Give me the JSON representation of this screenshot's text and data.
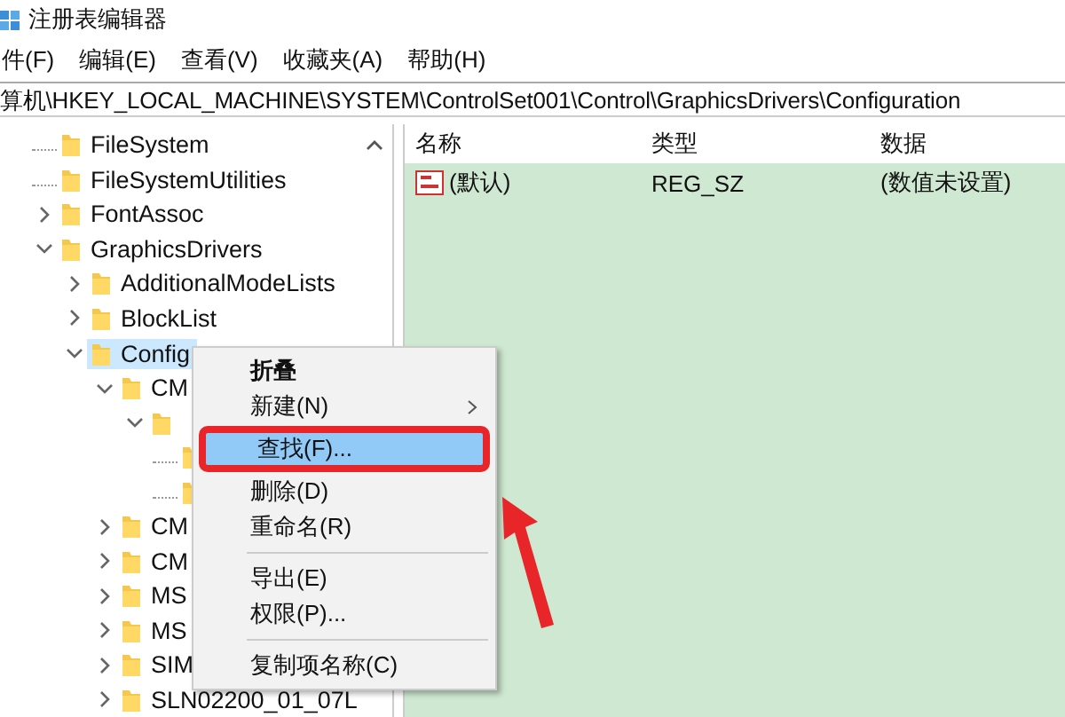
{
  "window": {
    "title": "注册表编辑器"
  },
  "menu_bar": [
    "件(F)",
    "编辑(E)",
    "查看(V)",
    "收藏夹(A)",
    "帮助(H)"
  ],
  "address_bar": {
    "value": "算机\\HKEY_LOCAL_MACHINE\\SYSTEM\\ControlSet001\\Control\\GraphicsDrivers\\Configuration"
  },
  "tree": [
    {
      "label": "FileSystem",
      "kind": "leaf",
      "selected": false
    },
    {
      "label": "FileSystemUtilities",
      "kind": "leaf",
      "selected": false
    },
    {
      "label": "FontAssoc",
      "kind": "branch",
      "expanded": false,
      "selected": false
    },
    {
      "label": "GraphicsDrivers",
      "kind": "branch",
      "expanded": true,
      "selected": false,
      "children": [
        {
          "label": "AdditionalModeLists",
          "kind": "branch",
          "expanded": false,
          "selected": false
        },
        {
          "label": "BlockList",
          "kind": "branch",
          "expanded": false,
          "selected": false
        },
        {
          "label": "Config",
          "kind": "branch",
          "expanded": true,
          "selected": true,
          "children": [
            {
              "label": "CM",
              "kind": "branch",
              "expanded": true,
              "selected": false,
              "children": [
                {
                  "kind": "branch",
                  "expanded": true,
                  "selected": false,
                  "children": [
                    {
                      "kind": "leaf",
                      "selected": false
                    },
                    {
                      "kind": "leaf",
                      "selected": false
                    }
                  ]
                }
              ]
            },
            {
              "label": "CM",
              "kind": "branch",
              "expanded": false,
              "selected": false
            },
            {
              "label": "CM",
              "kind": "branch",
              "expanded": false,
              "selected": false
            },
            {
              "label": "MS",
              "kind": "branch",
              "expanded": false,
              "selected": false
            },
            {
              "label": "MS",
              "kind": "branch",
              "expanded": false,
              "selected": false
            },
            {
              "label": "SIM",
              "kind": "branch",
              "expanded": false,
              "selected": false
            },
            {
              "label": "SLN02200_01_07L",
              "kind": "branch",
              "expanded": false,
              "selected": false
            }
          ]
        }
      ]
    }
  ],
  "table": {
    "columns": [
      "名称",
      "类型",
      "数据"
    ],
    "rows": [
      {
        "name": "(默认)",
        "type": "REG_SZ",
        "data": "(数值未设置)"
      }
    ]
  },
  "context_menu": {
    "items": [
      {
        "kind": "item",
        "label": "折叠",
        "bold": true,
        "submenu": false,
        "selected": false
      },
      {
        "kind": "item",
        "label": "新建(N)",
        "bold": false,
        "submenu": true,
        "selected": false
      },
      {
        "kind": "item",
        "label": "查找(F)...",
        "bold": false,
        "submenu": false,
        "selected": true
      },
      {
        "kind": "item",
        "label": "删除(D)",
        "bold": false,
        "submenu": false,
        "selected": false
      },
      {
        "kind": "item",
        "label": "重命名(R)",
        "bold": false,
        "submenu": false,
        "selected": false
      },
      {
        "kind": "separator"
      },
      {
        "kind": "item",
        "label": "导出(E)",
        "bold": false,
        "submenu": false,
        "selected": false
      },
      {
        "kind": "item",
        "label": "权限(P)...",
        "bold": false,
        "submenu": false,
        "selected": false
      },
      {
        "kind": "separator"
      },
      {
        "kind": "item",
        "label": "复制项名称(C)",
        "bold": false,
        "submenu": false,
        "selected": false
      }
    ]
  }
}
